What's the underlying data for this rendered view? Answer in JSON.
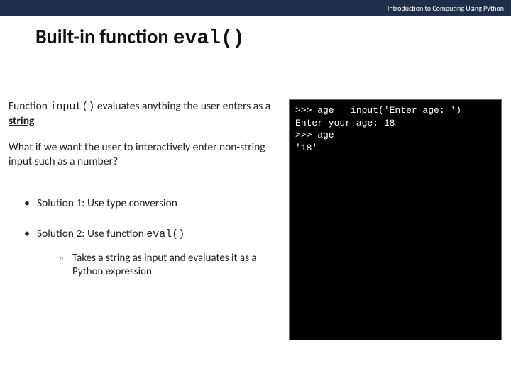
{
  "header": {
    "course": "Introduction to Computing Using Python"
  },
  "title": {
    "prefix": "Built-in function ",
    "code": "eval()"
  },
  "left": {
    "p1_a": "Function ",
    "p1_code": "input()",
    "p1_b": " evaluates anything the user enters as a ",
    "p1_u": "string",
    "p2": "What if we want the user to interactively enter non-string input such as a number?",
    "s1": "Solution 1: Use type conversion",
    "s2_a": "Solution 2: Use function ",
    "s2_code": "eval()",
    "sub": "Takes a string as input and evaluates it as a Python expression"
  },
  "code": {
    "l1": ">>> age = input('Enter age: ')",
    "l2": "Enter your age: 18",
    "l3": ">>> age",
    "l4": "'18'"
  }
}
